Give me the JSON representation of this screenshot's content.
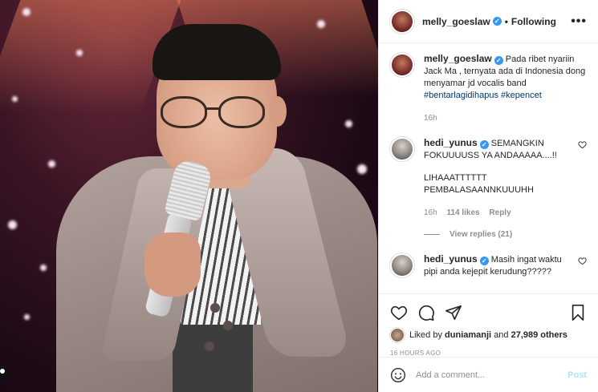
{
  "post": {
    "author": "melly_goeslaw",
    "follow_status": "Following",
    "more_label": "•••",
    "caption": {
      "username": "melly_goeslaw",
      "text": "Pada ribet nyariin Jack Ma , ternyata ada di Indonesia dong menyamar jd vocalis band",
      "hashtags": "#bentarlagidihapus #kepencet",
      "time": "16h"
    },
    "comments": [
      {
        "username": "hedi_yunus",
        "text_1": "SEMANGKIN FOKUUUUSS YA ANDAAAAA....!!",
        "text_2": "LIHAAATTTTTT PEMBALASAANNKUUUHH",
        "time": "16h",
        "likes": "114 likes",
        "reply": "Reply",
        "view_replies": "View replies (21)"
      },
      {
        "username": "hedi_yunus",
        "text": "Masih ingat waktu pipi anda kejepit kerudung?????"
      }
    ],
    "liked_by": {
      "prefix": "Liked by",
      "user": "duniamanji",
      "and": "and",
      "others": "27,989 others"
    },
    "timestamp": "16 HOURS AGO",
    "add_comment_placeholder": "Add a comment...",
    "post_button": "Post"
  },
  "icons": {
    "heart": "heart-icon",
    "comment": "comment-icon",
    "share": "share-icon",
    "save": "bookmark-icon",
    "emoji": "emoji-icon",
    "verified": "verified-badge-icon"
  },
  "colors": {
    "verified_blue": "#3897f0",
    "hashtag": "#00376b",
    "post_disabled": "#b2dffc",
    "muted": "#8e8e8e"
  }
}
